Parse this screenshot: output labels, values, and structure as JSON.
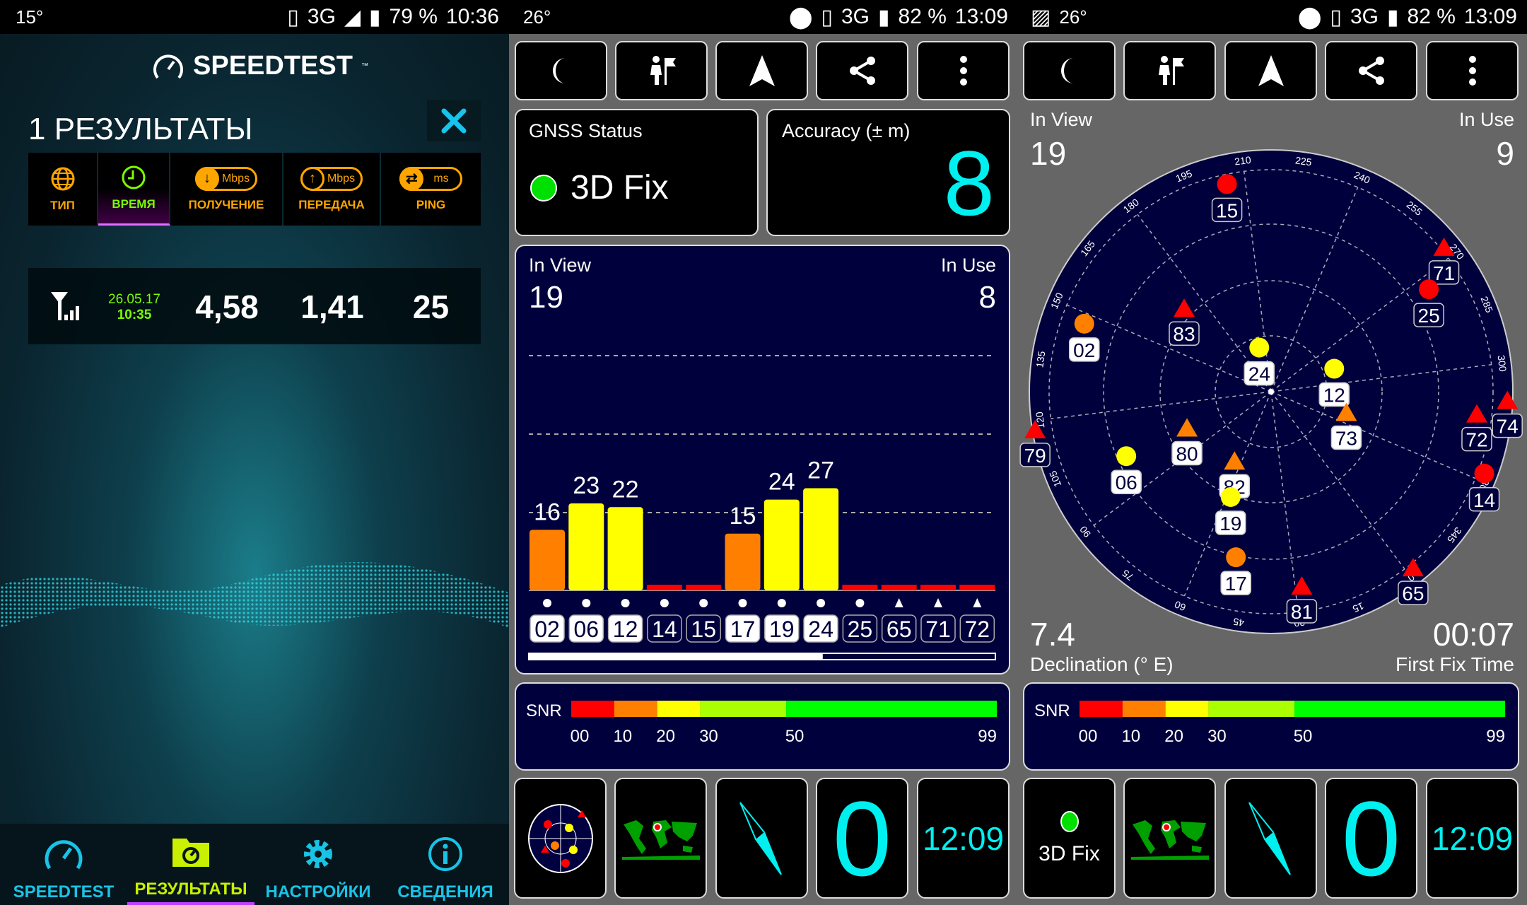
{
  "speedtest": {
    "status_bar": {
      "temperature": "15°",
      "network": "3G",
      "network_sup": "3G",
      "battery": "79 %",
      "time": "10:36"
    },
    "logo": "SPEEDTEST",
    "title": "1 РЕЗУЛЬТАТЫ",
    "columns": [
      {
        "label": "ТИП",
        "icon": "globe-icon"
      },
      {
        "label": "ВРЕМЯ",
        "icon": "clock-icon"
      },
      {
        "label": "ПОЛУЧЕНИЕ",
        "unit": "Mbps",
        "icon": "download-icon"
      },
      {
        "label": "ПЕРЕДАЧА",
        "unit": "Mbps",
        "icon": "upload-icon"
      },
      {
        "label": "PING",
        "unit": "ms",
        "icon": "ping-icon"
      }
    ],
    "active_column": "ВРЕМЯ",
    "result": {
      "type_icon": "cell-signal-icon",
      "date": "26.05.17",
      "time": "10:35",
      "download": "4,58",
      "upload": "1,41",
      "ping": "25"
    },
    "nav": [
      {
        "label": "SPEEDTEST",
        "icon": "speedometer-icon"
      },
      {
        "label": "РЕЗУЛЬТАТЫ",
        "icon": "results-folder-icon",
        "active": true
      },
      {
        "label": "НАСТРОЙКИ",
        "icon": "gear-icon"
      },
      {
        "label": "СВЕДЕНИЯ",
        "icon": "info-icon"
      }
    ],
    "colors": {
      "accent": "#19c3e6",
      "active": "#c8f000",
      "column": "#ffa500"
    }
  },
  "gps_status": {
    "status_bar": {
      "temperature": "26°",
      "network": "3G",
      "battery": "82 %",
      "time": "13:09"
    },
    "toolbar": [
      "moon-icon",
      "hiker-flag-icon",
      "navigation-arrow-icon",
      "share-icon",
      "more-vert-icon"
    ],
    "gnss_label": "GNSS Status",
    "fix": "3D Fix",
    "accuracy_label": "Accuracy (± m)",
    "accuracy": "8",
    "in_view_label": "In View",
    "in_view": "19",
    "in_use_label": "In Use",
    "in_use": "8",
    "scroll_position": 0.63,
    "snr": {
      "label": "SNR",
      "ticks": [
        "00",
        "10",
        "20",
        "30",
        "50",
        "99"
      ]
    },
    "tiles": {
      "speed": "0",
      "clock": "12:09"
    }
  },
  "gps_radar": {
    "status_bar": {
      "temperature": "26°",
      "network": "3G",
      "battery": "82 %",
      "time": "13:09"
    },
    "in_view_label": "In View",
    "in_view": "19",
    "in_use_label": "In Use",
    "in_use": "9",
    "declination": "7.4",
    "declination_label": "Declination (° E)",
    "first_fix": "00:07",
    "first_fix_label": "First Fix Time",
    "snr": {
      "label": "SNR",
      "ticks": [
        "00",
        "10",
        "20",
        "30",
        "50",
        "99"
      ]
    },
    "tiles": {
      "fix": "3D Fix",
      "speed": "0",
      "clock": "12:09"
    }
  },
  "chart_data": [
    {
      "type": "bar",
      "categories": [
        "02",
        "06",
        "12",
        "14",
        "15",
        "17",
        "19",
        "24",
        "25",
        "65",
        "71",
        "72"
      ],
      "values": [
        16,
        23,
        22,
        0,
        0,
        15,
        24,
        27,
        0,
        0,
        0,
        0
      ],
      "data_labels": [
        "16",
        "23",
        "22",
        "",
        "",
        "15",
        "24",
        "27",
        "",
        "",
        "",
        ""
      ],
      "in_use": [
        true,
        true,
        true,
        false,
        false,
        true,
        true,
        true,
        false,
        false,
        false,
        false
      ],
      "shapes": [
        "circle",
        "circle",
        "circle",
        "circle",
        "circle",
        "circle",
        "circle",
        "circle",
        "circle",
        "triangle",
        "triangle",
        "triangle"
      ],
      "xlabel": "",
      "ylabel": "",
      "grid": true,
      "color_scale": {
        "0-10": "#ff0000",
        "10-20": "#ff8000",
        "20-30": "#ffff00",
        "30-50": "#aaff00",
        "50-99": "#00ff00"
      }
    },
    {
      "type": "scatter",
      "coordinate_system": "polar (azimuth, elevation)",
      "azimuth_labels": [
        "0",
        "15",
        "30",
        "45",
        "60",
        "75",
        "90",
        "105",
        "120",
        "135",
        "150",
        "165",
        "180",
        "195",
        "210",
        "225",
        "240",
        "255",
        "270",
        "285",
        "300",
        "315",
        "330",
        "345"
      ],
      "satellites": [
        {
          "id": "15",
          "azimuth": 205,
          "elevation": 11,
          "shape": "circle",
          "color": "#ff0000",
          "in_use": false
        },
        {
          "id": "71",
          "azimuth": 267,
          "elevation": 6,
          "shape": "triangle",
          "color": "#ff0000",
          "in_use": false
        },
        {
          "id": "25",
          "azimuth": 274,
          "elevation": 20,
          "shape": "circle",
          "color": "#ff0000",
          "in_use": false
        },
        {
          "id": "02",
          "azimuth": 147,
          "elevation": 16,
          "shape": "circle",
          "color": "#ff8000",
          "in_use": true
        },
        {
          "id": "83",
          "azimuth": 171,
          "elevation": 45,
          "shape": "triangle",
          "color": "#ff0000",
          "in_use": false
        },
        {
          "id": "24",
          "azimuth": 202,
          "elevation": 73,
          "shape": "circle",
          "color": "#ffff00",
          "in_use": true
        },
        {
          "id": "12",
          "azimuth": 287,
          "elevation": 65,
          "shape": "circle",
          "color": "#ffff00",
          "in_use": true
        },
        {
          "id": "73",
          "azimuth": 322,
          "elevation": 61,
          "shape": "triangle",
          "color": "#ff8000",
          "in_use": true
        },
        {
          "id": "74",
          "azimuth": 309,
          "elevation": 2,
          "shape": "triangle",
          "color": "#ff0000",
          "in_use": false
        },
        {
          "id": "72",
          "azimuth": 313,
          "elevation": 13,
          "shape": "triangle",
          "color": "#ff0000",
          "in_use": false
        },
        {
          "id": "14",
          "azimuth": 328,
          "elevation": 5,
          "shape": "circle",
          "color": "#ff0000",
          "in_use": false
        },
        {
          "id": "79",
          "azimuth": 118,
          "elevation": 0,
          "shape": "triangle",
          "color": "#ff0000",
          "in_use": false
        },
        {
          "id": "80",
          "azimuth": 104,
          "elevation": 56,
          "shape": "triangle",
          "color": "#ff8000",
          "in_use": true
        },
        {
          "id": "06",
          "azimuth": 103,
          "elevation": 31,
          "shape": "circle",
          "color": "#ffff00",
          "in_use": true
        },
        {
          "id": "82",
          "azimuth": 65,
          "elevation": 61,
          "shape": "triangle",
          "color": "#ff8000",
          "in_use": true
        },
        {
          "id": "19",
          "azimuth": 58,
          "elevation": 48,
          "shape": "circle",
          "color": "#ffff00",
          "in_use": true
        },
        {
          "id": "17",
          "azimuth": 49,
          "elevation": 27,
          "shape": "circle",
          "color": "#ff8000",
          "in_use": true
        },
        {
          "id": "81",
          "azimuth": 28,
          "elevation": 17,
          "shape": "triangle",
          "color": "#ff0000",
          "in_use": false
        },
        {
          "id": "65",
          "azimuth": 358,
          "elevation": 6,
          "shape": "triangle",
          "color": "#ff0000",
          "in_use": false
        }
      ]
    }
  ]
}
